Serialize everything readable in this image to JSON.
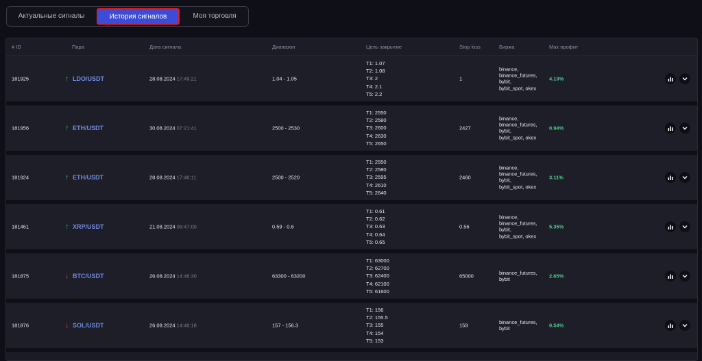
{
  "tabs": [
    {
      "label": "Актуальные сигналы"
    },
    {
      "label": "История сигналов"
    },
    {
      "label": "Моя торговля"
    }
  ],
  "columns": {
    "id": "# ID",
    "pair": "Пара",
    "date": "Дата сигнала",
    "range": "Диапазон",
    "targets": "Цель закрытие",
    "stop": "Stop loss",
    "exchange": "Биржа",
    "profit": "Max профит"
  },
  "rows": [
    {
      "id": "181925",
      "direction": "up",
      "arrow": "↑",
      "pair": "LDO/USDT",
      "date": "28.08.2024",
      "time": "17:49:21",
      "range": "1.04 - 1.05",
      "targets": "T1: 1.07\nT2: 1.08\nT3: 2\nT4: 2.1\nT5: 2.2",
      "stop": "1",
      "exchange": "binance,\nbinance_futures,\nbybit,\nbybit_spot, okex",
      "profit": "4.13%"
    },
    {
      "id": "181956",
      "direction": "up",
      "arrow": "↑",
      "pair": "ETH/USDT",
      "date": "30.08.2024",
      "time": "07:21:41",
      "range": "2500 - 2530",
      "targets": "T1: 2550\nT2: 2580\nT3: 2600\nT4: 2630\nT5: 2650",
      "stop": "2427",
      "exchange": "binance,\nbinance_futures,\nbybit,\nbybit_spot, okex",
      "profit": "0.94%"
    },
    {
      "id": "181924",
      "direction": "up",
      "arrow": "↑",
      "pair": "ETH/USDT",
      "date": "28.08.2024",
      "time": "17:48:11",
      "range": "2500 - 2520",
      "targets": "T1: 2550\nT2: 2580\nT3: 2595\nT4: 2610\nT5: 2640",
      "stop": "2460",
      "exchange": "binance,\nbinance_futures,\nbybit,\nbybit_spot, okex",
      "profit": "3.11%"
    },
    {
      "id": "181461",
      "direction": "up",
      "arrow": "↑",
      "pair": "XRP/USDT",
      "date": "21.08.2024",
      "time": "06:47:00",
      "range": "0.59 - 0.6",
      "targets": "T1: 0.61\nT2: 0.62\nT3: 0.63\nT4: 0.64\nT5: 0.65",
      "stop": "0.56",
      "exchange": "binance,\nbinance_futures,\nbybit,\nbybit_spot, okex",
      "profit": "5.35%"
    },
    {
      "id": "181875",
      "direction": "down",
      "arrow": "↓",
      "pair": "BTC/USDT",
      "date": "26.08.2024",
      "time": "14:46:30",
      "range": "63300 - 63200",
      "targets": "T1: 63000\nT2: 62700\nT3: 62400\nT4: 62100\nT5: 61600",
      "stop": "65000",
      "exchange": "binance_futures,\nbybit",
      "profit": "2.65%"
    },
    {
      "id": "181876",
      "direction": "down",
      "arrow": "↓",
      "pair": "SOL/USDT",
      "date": "26.08.2024",
      "time": "14:48:18",
      "range": "157 - 156.3",
      "targets": "T1: 156\nT2: 155.5\nT3: 155\nT4: 154\nT5: 153",
      "stop": "159",
      "exchange": "binance_futures,\nbybit",
      "profit": "0.54%"
    }
  ],
  "icons": {
    "chart": "bar-chart-icon",
    "expand": "chevron-down-icon",
    "up": "arrow-up-icon",
    "down": "arrow-down-icon"
  },
  "colors": {
    "accent": "#3d4bd6",
    "up": "#2fbf71",
    "down": "#e0443e",
    "profit": "#4fd08b",
    "pair": "#6f8ae0"
  }
}
